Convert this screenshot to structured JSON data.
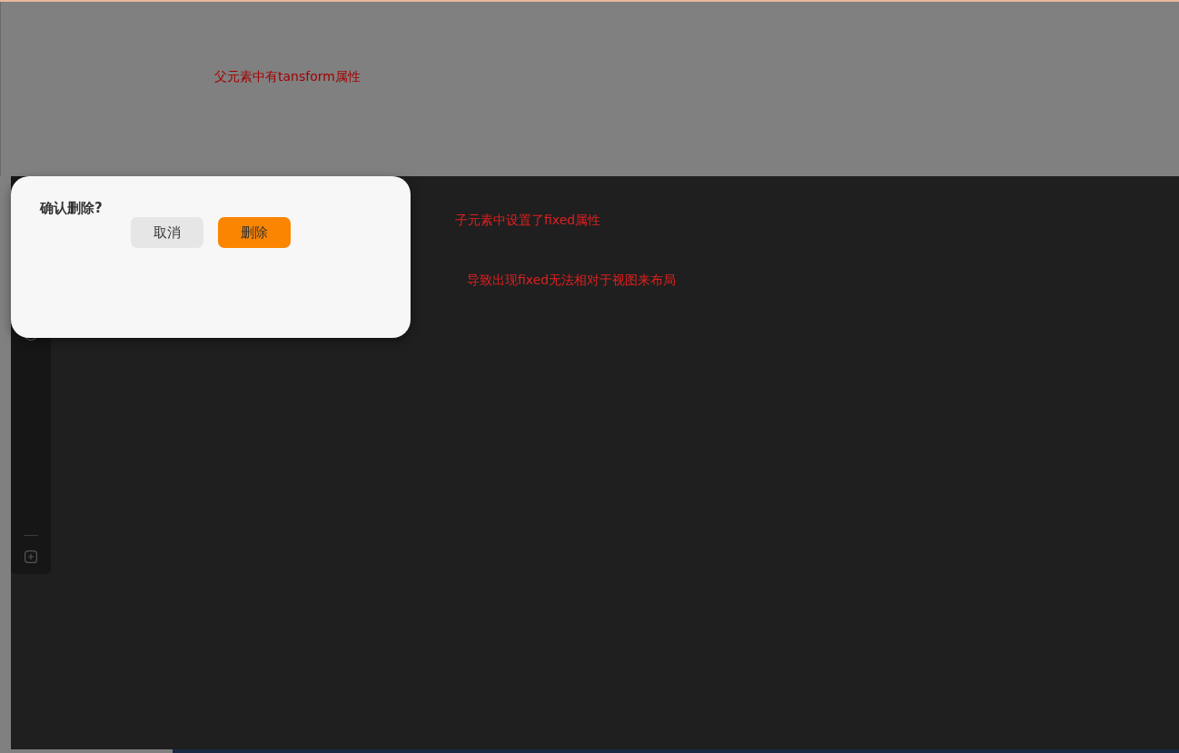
{
  "parent_area": {
    "note": "父元素中有tansform属性"
  },
  "child_area": {
    "notes": [
      "子元素中设置了fixed属性",
      "导致出现fixed无法相对于视图来布局"
    ]
  },
  "dialog": {
    "title": "确认删除?",
    "buttons": [
      {
        "label": "取消",
        "kind": "secondary"
      },
      {
        "label": "删除",
        "kind": "primary"
      }
    ]
  }
}
